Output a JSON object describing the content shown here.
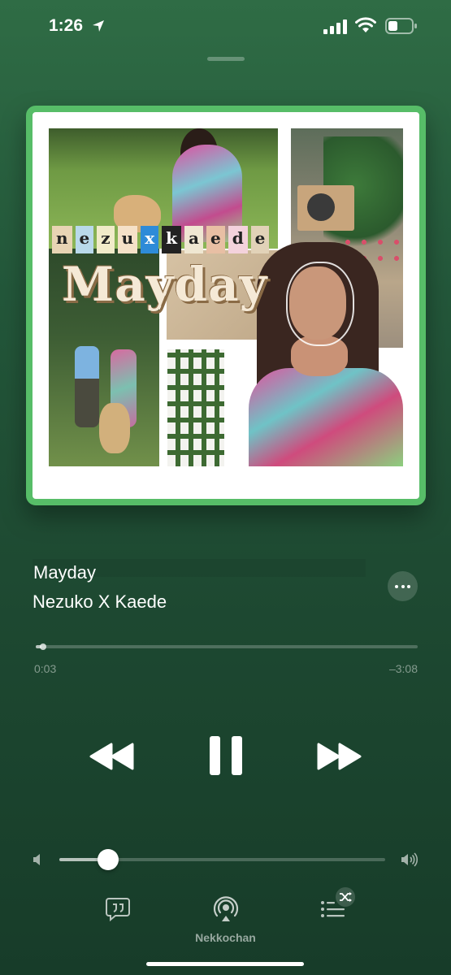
{
  "status_bar": {
    "time": "1:26"
  },
  "artwork": {
    "stickers": [
      "n",
      "e",
      "z",
      "u",
      "x",
      "k",
      "a",
      "e",
      "d",
      "e"
    ],
    "title": "Mayday",
    "frame_color": "#57bd68"
  },
  "track": {
    "title": "Mayday",
    "artist": "Nezuko X Kaede"
  },
  "playback": {
    "elapsed": "0:03",
    "remaining": "–3:08",
    "progress": 0.015,
    "state": "playing"
  },
  "volume": {
    "level": 0.15
  },
  "output": {
    "device_name": "Nekkochan"
  },
  "icons": {
    "location": "location-arrow-icon",
    "signal": "cellular-signal-icon",
    "wifi": "wifi-icon",
    "battery": "battery-icon",
    "more": "ellipsis-icon",
    "rewind": "rewind-icon",
    "pause": "pause-icon",
    "fast_forward": "fast-forward-icon",
    "volume_low": "speaker-low-icon",
    "volume_high": "speaker-high-icon",
    "lyrics": "lyrics-quote-icon",
    "airplay": "airplay-audio-icon",
    "queue": "queue-list-icon",
    "shuffle": "shuffle-icon"
  }
}
